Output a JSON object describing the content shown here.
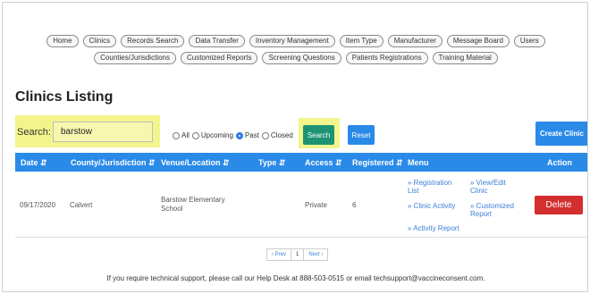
{
  "nav": {
    "row1": [
      "Home",
      "Clinics",
      "Records Search",
      "Data Transfer",
      "Inventory Management",
      "Item Type",
      "Manufacturer",
      "Message Board",
      "Users"
    ],
    "row2": [
      "Counties/Jurisdictions",
      "Customized Reports",
      "Screening Questions",
      "Patients Registrations",
      "Training Material"
    ]
  },
  "page": {
    "title": "Clinics Listing"
  },
  "search": {
    "label": "Search:",
    "value": "barstow",
    "filters": [
      {
        "label": "All",
        "checked": false
      },
      {
        "label": "Upcoming",
        "checked": false
      },
      {
        "label": "Past",
        "checked": true
      },
      {
        "label": "Closed",
        "checked": false
      }
    ],
    "search_button": "Search",
    "reset_button": "Reset",
    "create_button": "Create Clinic"
  },
  "table": {
    "headers": [
      "Date",
      "County/Jurisdiction",
      "Venue/Location",
      "Type",
      "Access",
      "Registered",
      "Menu",
      "Action"
    ],
    "sort_icon": "⇵",
    "rows": [
      {
        "date": "09/17/2020",
        "county": "Calvert",
        "venue_line1": "Barstow Elementary",
        "venue_line2": "School",
        "type": "",
        "access": "Private",
        "registered": "6",
        "menu": {
          "registration_l1": "» Registration",
          "registration_l2": "List",
          "view_edit_l1": "» View/Edit",
          "view_edit_l2": "Clinic",
          "clinic_activity": "» Clinic Activity",
          "customized_l1": "» Customized",
          "customized_l2": "Report",
          "activity_report": "» Activity Report"
        },
        "action": "Delete"
      }
    ]
  },
  "pagination": {
    "prev": "‹ Prev",
    "current": "1",
    "next": "Next ›"
  },
  "footer": {
    "text": "If you require technical support, please call our Help Desk at 888-503-0515 or email techsupport@vaccineconsent.com."
  },
  "colors": {
    "primary": "#2a8ae8",
    "search": "#1d9374",
    "delete": "#d32f2f",
    "highlight": "#f3f58c",
    "link": "#3b7fd8"
  }
}
